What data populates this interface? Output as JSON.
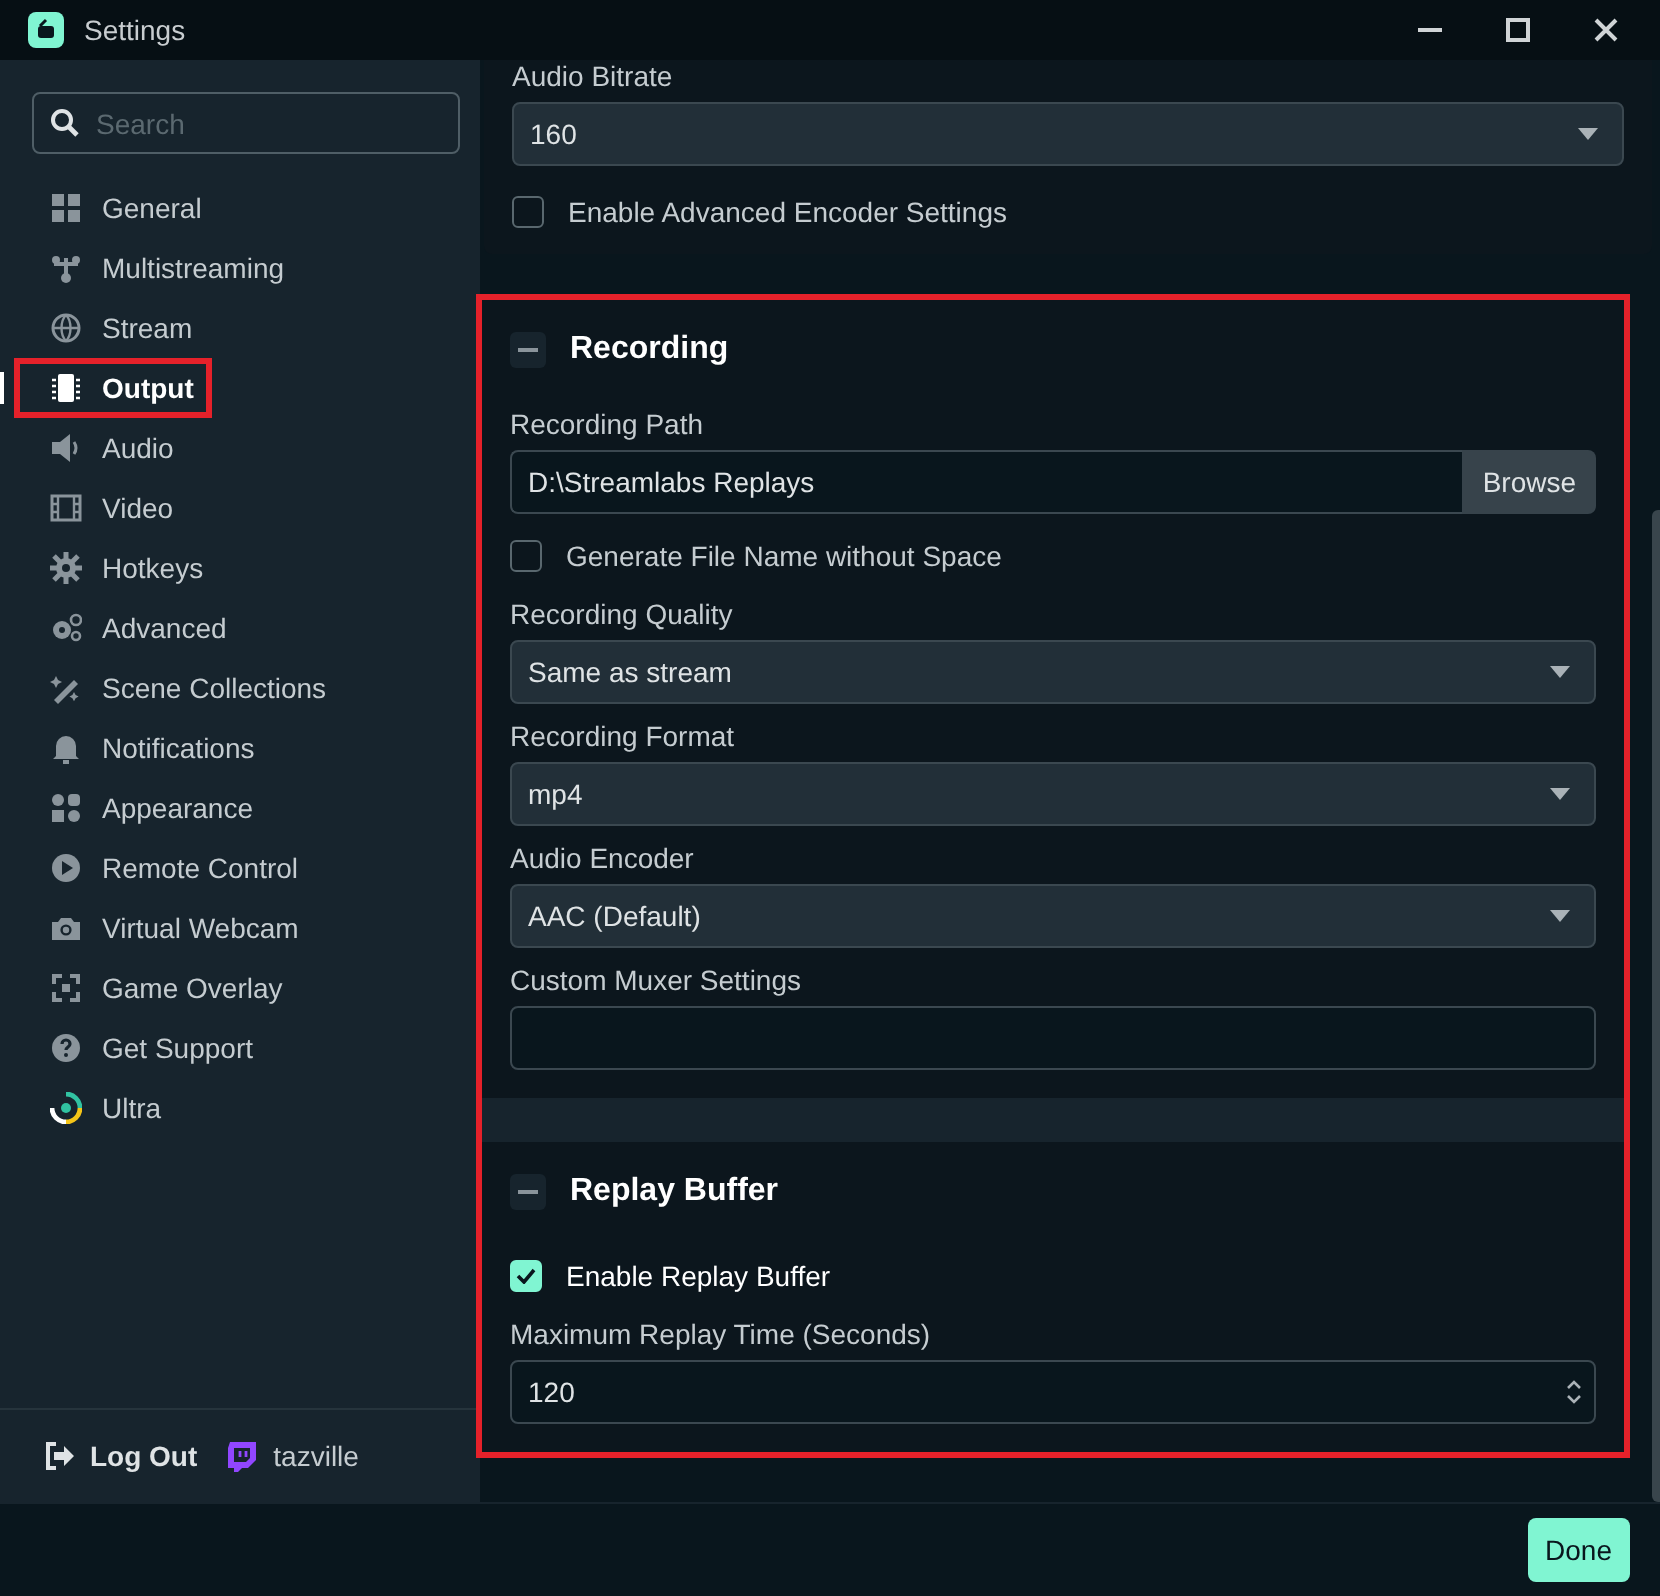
{
  "window": {
    "title": "Settings"
  },
  "sidebar": {
    "search": {
      "placeholder": "Search"
    },
    "items": [
      {
        "label": "General",
        "selected": false,
        "highlighted": false
      },
      {
        "label": "Multistreaming",
        "selected": false,
        "highlighted": false
      },
      {
        "label": "Stream",
        "selected": false,
        "highlighted": false
      },
      {
        "label": "Output",
        "selected": true,
        "highlighted": true
      },
      {
        "label": "Audio",
        "selected": false,
        "highlighted": false
      },
      {
        "label": "Video",
        "selected": false,
        "highlighted": false
      },
      {
        "label": "Hotkeys",
        "selected": false,
        "highlighted": false
      },
      {
        "label": "Advanced",
        "selected": false,
        "highlighted": false
      },
      {
        "label": "Scene Collections",
        "selected": false,
        "highlighted": false
      },
      {
        "label": "Notifications",
        "selected": false,
        "highlighted": false
      },
      {
        "label": "Appearance",
        "selected": false,
        "highlighted": false
      },
      {
        "label": "Remote Control",
        "selected": false,
        "highlighted": false
      },
      {
        "label": "Virtual Webcam",
        "selected": false,
        "highlighted": false
      },
      {
        "label": "Game Overlay",
        "selected": false,
        "highlighted": false
      },
      {
        "label": "Get Support",
        "selected": false,
        "highlighted": false
      },
      {
        "label": "Ultra",
        "selected": false,
        "highlighted": false
      }
    ],
    "account": {
      "logout": "Log Out",
      "username": "tazville"
    }
  },
  "top_panel": {
    "fields": [
      {
        "kind": "select",
        "label": "Audio Bitrate",
        "value": "160"
      },
      {
        "kind": "checkbox",
        "label": "Enable Advanced Encoder Settings",
        "checked": false
      }
    ]
  },
  "highlight_group": {
    "highlighted": true,
    "sections": [
      {
        "title": "Recording",
        "expanded": true,
        "fields": [
          {
            "kind": "path",
            "label": "Recording Path",
            "value": "D:\\Streamlabs Replays",
            "button": "Browse"
          },
          {
            "kind": "checkbox",
            "label": "Generate File Name without Space",
            "checked": false
          },
          {
            "kind": "select",
            "label": "Recording Quality",
            "value": "Same as stream"
          },
          {
            "kind": "select",
            "label": "Recording Format",
            "value": "mp4"
          },
          {
            "kind": "select",
            "label": "Audio Encoder",
            "value": "AAC (Default)"
          },
          {
            "kind": "text",
            "label": "Custom Muxer Settings"
          }
        ]
      },
      {
        "title": "Replay Buffer",
        "expanded": true,
        "fields": [
          {
            "kind": "checkbox",
            "label": "Enable Replay Buffer",
            "checked": true
          },
          {
            "kind": "number",
            "label": "Maximum Replay Time (Seconds)",
            "value": "120"
          }
        ]
      }
    ]
  },
  "footer": {
    "done": "Done"
  }
}
